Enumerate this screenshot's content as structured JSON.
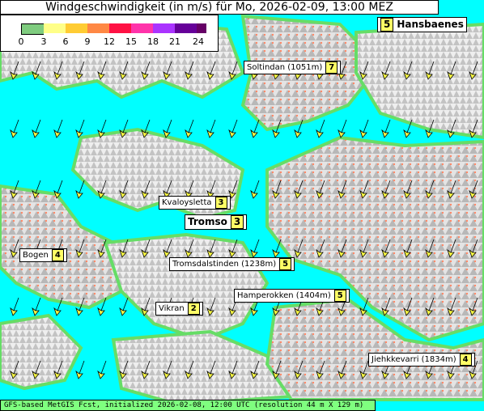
{
  "title": "Windgeschwindigkeit (in m/s) für Mo, 2026-02-09, 13:00 MEZ",
  "legend": {
    "ticks": [
      "0",
      "3",
      "6",
      "9",
      "12",
      "15",
      "18",
      "21",
      "24"
    ],
    "colors": [
      "#7fcc7f",
      "#ffff88",
      "#ffcc33",
      "#ff8844",
      "#ff1144",
      "#ff33aa",
      "#aa33ff",
      "#660099"
    ]
  },
  "places": [
    {
      "name": "Hansbaenes",
      "wind": "5"
    },
    {
      "name": "Soltindan (1051m)",
      "wind": "7"
    },
    {
      "name": "Kvaloysletta",
      "wind": "3"
    },
    {
      "name": "Tromso",
      "wind": "3"
    },
    {
      "name": "Bogen",
      "wind": "4"
    },
    {
      "name": "Tromsdalstinden (1238m)",
      "wind": "5"
    },
    {
      "name": "Hamperokken (1404m)",
      "wind": "5"
    },
    {
      "name": "Vikran",
      "wind": "2"
    },
    {
      "name": "Jiehkkevarri (1834m)",
      "wind": "4"
    }
  ],
  "footer": "GFS-based MetGIS Fcst, initialized 2026-02-08, 12:00 UTC  (resolution 44 m X 129 m)",
  "colors": {
    "water": "#00ffff",
    "lowland": "#66dd66",
    "snow": "#f2f2f2",
    "rock": "#999999",
    "arrow": "#ffff44"
  }
}
